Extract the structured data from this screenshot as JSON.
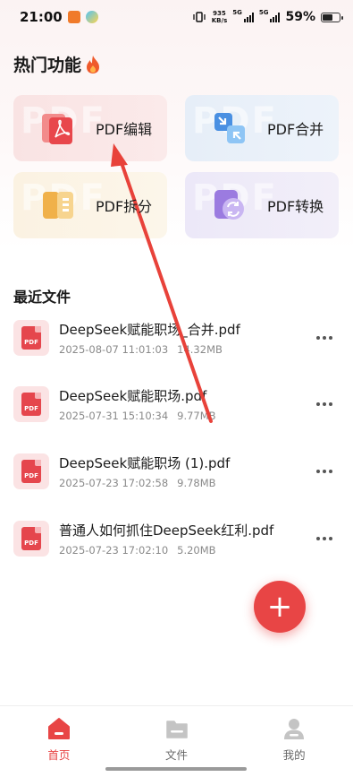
{
  "status_bar": {
    "time": "21:00",
    "net_speed_value": "935",
    "net_speed_unit": "KB/s",
    "signal_1": "5G",
    "signal_2": "5G",
    "battery": "59%"
  },
  "hot_features": {
    "title": "热门功能",
    "items": [
      {
        "label": "PDF编辑",
        "icon": "pdf-edit-icon",
        "bgtext": "PDF"
      },
      {
        "label": "PDF合并",
        "icon": "pdf-merge-icon",
        "bgtext": "PDF"
      },
      {
        "label": "PDF拆分",
        "icon": "pdf-split-icon",
        "bgtext": "PDF"
      },
      {
        "label": "PDF转换",
        "icon": "pdf-convert-icon",
        "bgtext": "PDF"
      }
    ]
  },
  "recent_files": {
    "title": "最近文件",
    "thumb_label": "PDF",
    "items": [
      {
        "name": "DeepSeek赋能职场_合并.pdf",
        "datetime": "2025-08-07 11:01:03",
        "size": "14.32MB"
      },
      {
        "name": "DeepSeek赋能职场.pdf",
        "datetime": "2025-07-31 15:10:34",
        "size": "9.77MB"
      },
      {
        "name": "DeepSeek赋能职场 (1).pdf",
        "datetime": "2025-07-23 17:02:58",
        "size": "9.78MB"
      },
      {
        "name": "普通人如何抓住DeepSeek红利.pdf",
        "datetime": "2025-07-23 17:02:10",
        "size": "5.20MB"
      }
    ]
  },
  "fab": {
    "label": "+"
  },
  "bottom_nav": {
    "items": [
      {
        "label": "首页",
        "icon": "home-icon",
        "active": true
      },
      {
        "label": "文件",
        "icon": "folder-icon",
        "active": false
      },
      {
        "label": "我的",
        "icon": "user-icon",
        "active": false
      }
    ]
  },
  "colors": {
    "accent": "#e84545",
    "annotation_arrow": "#e8423a"
  }
}
